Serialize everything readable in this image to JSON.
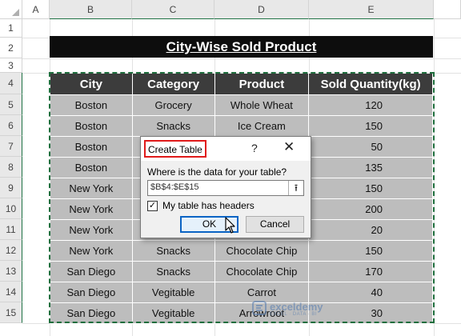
{
  "columns": [
    "A",
    "B",
    "C",
    "D",
    "E"
  ],
  "rows": [
    "1",
    "2",
    "3",
    "4",
    "5",
    "6",
    "7",
    "8",
    "9",
    "10",
    "11",
    "12",
    "13",
    "14",
    "15"
  ],
  "title": "City-Wise Sold Product",
  "table": {
    "headers": [
      "City",
      "Category",
      "Product",
      "Sold Quantity(kg)"
    ],
    "rows": [
      [
        "Boston",
        "Grocery",
        "Whole Wheat",
        "120"
      ],
      [
        "Boston",
        "Snacks",
        "Ice Cream",
        "150"
      ],
      [
        "Boston",
        "",
        "",
        "50"
      ],
      [
        "Boston",
        "",
        "",
        "135"
      ],
      [
        "New York",
        "",
        "",
        "150"
      ],
      [
        "New York",
        "",
        "",
        "200"
      ],
      [
        "New York",
        "",
        "",
        "20"
      ],
      [
        "New York",
        "Snacks",
        "Chocolate Chip",
        "150"
      ],
      [
        "San Diego",
        "Snacks",
        "Chocolate Chip",
        "170"
      ],
      [
        "San Diego",
        "Vegitable",
        "Carrot",
        "40"
      ],
      [
        "San Diego",
        "Vegitable",
        "Arrowroot",
        "30"
      ]
    ]
  },
  "dialog": {
    "title": "Create Table",
    "help": "?",
    "close": "✕",
    "prompt": "Where is the data for your table?",
    "range": "$B$4:$E$15",
    "collapse_icon": "⭱",
    "checkbox_checked": "✓",
    "checkbox_label": "My table has headers",
    "ok": "OK",
    "cancel": "Cancel"
  },
  "watermark": {
    "name": "exceldemy",
    "tagline": "EXCEL · DATA · BI"
  },
  "colors": {
    "title_bg": "#0d0d0d",
    "header_bg": "#3c3c3c",
    "cell_bg": "#bdbdbd",
    "highlight_red": "#e01b1b",
    "ok_border": "#0b64c4",
    "marquee": "#1f6e3d"
  }
}
